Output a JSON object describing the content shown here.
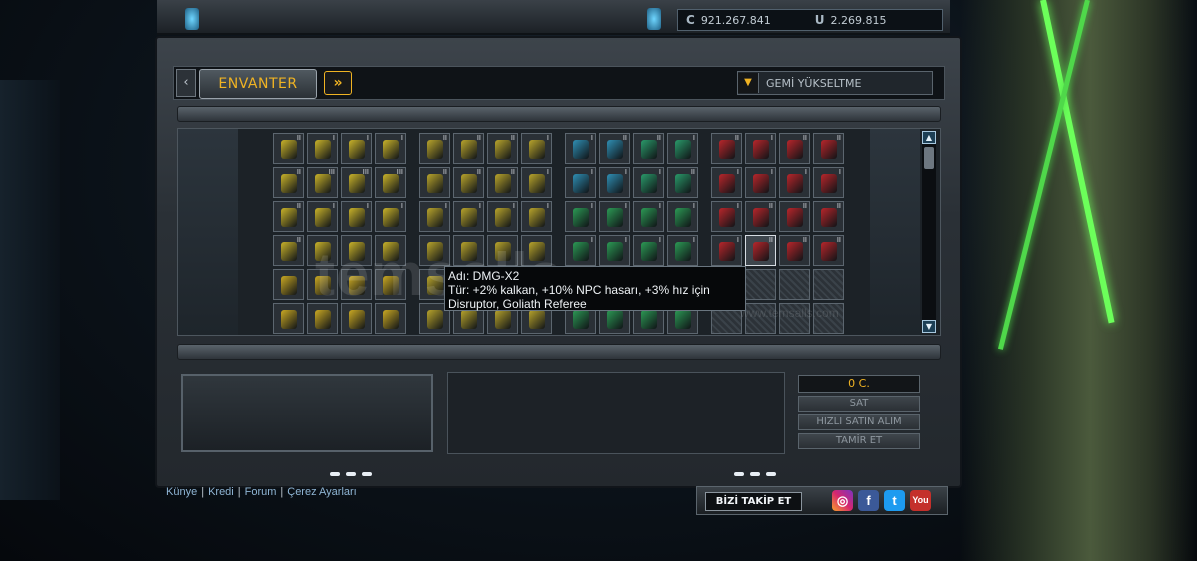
{
  "currency": {
    "credits": "921.267.841",
    "uridium": "2.269.815"
  },
  "tabs": {
    "inventory_label": "ENVANTER",
    "upgrade_select": "GEMİ YÜKSELTME"
  },
  "tooltip": {
    "line1": "Adı: DMG-X2",
    "line2": "Tür: +2% kalkan, +10% NPC hasarı, +3% hız için",
    "line3": "Disruptor, Goliath Referee"
  },
  "watermark": "temsalls",
  "watermark_sub": "www.temsalls.com",
  "actions": {
    "price": "0 C.",
    "sell": "SAT",
    "quick_buy": "HIZLI SATIN ALIM",
    "repair": "TAMİR ET"
  },
  "footer": {
    "links": [
      "Künye",
      "Kredi",
      "Forum",
      "Çerez Ayarları"
    ]
  },
  "follow": {
    "label": "BİZİ TAKİP ET",
    "icons": [
      "instagram-icon",
      "facebook-icon",
      "twitter-icon",
      "youtube-icon"
    ],
    "youtube_text": "You"
  },
  "inventory": {
    "groups": [
      {
        "name": "yellow",
        "color": "#c9b32a",
        "rows": [
          [
            "II",
            "I",
            "I",
            "I"
          ],
          [
            "II",
            "III",
            "III",
            "III"
          ],
          [
            "II",
            "I",
            "I",
            "I"
          ],
          [
            "II",
            "",
            "",
            ""
          ],
          [
            "",
            "",
            "",
            ""
          ],
          [
            "",
            "",
            "",
            ""
          ]
        ]
      },
      {
        "name": "olive",
        "color": "#b9a52c",
        "rows": [
          [
            "II",
            "II",
            "II",
            "I"
          ],
          [
            "II",
            "II",
            "II",
            "I"
          ],
          [
            "I",
            "I",
            "I",
            "I"
          ],
          [
            "",
            "",
            "",
            ""
          ],
          [
            "",
            "",
            "",
            ""
          ],
          [
            "",
            "",
            "",
            ""
          ]
        ]
      },
      {
        "name": "blue-green",
        "color": "#2f8fb4",
        "rows": [
          [
            "I",
            "II",
            "II",
            "I"
          ],
          [
            "I",
            "I",
            "I",
            "II"
          ],
          [
            "I",
            "I",
            "I",
            "I"
          ],
          [
            "I",
            "I",
            "I",
            "I"
          ],
          [
            "",
            "",
            "",
            ""
          ],
          [
            "",
            "",
            "",
            ""
          ]
        ]
      },
      {
        "name": "red",
        "color": "#b8262b",
        "rows": [
          [
            "II",
            "I",
            "II",
            "II"
          ],
          [
            "I",
            "I",
            "I",
            "I"
          ],
          [
            "I",
            "II",
            "II",
            "II"
          ],
          [
            "I",
            "II",
            "II",
            "II"
          ],
          [
            "",
            "",
            "",
            ""
          ],
          [
            "",
            "",
            "",
            ""
          ]
        ]
      }
    ]
  }
}
